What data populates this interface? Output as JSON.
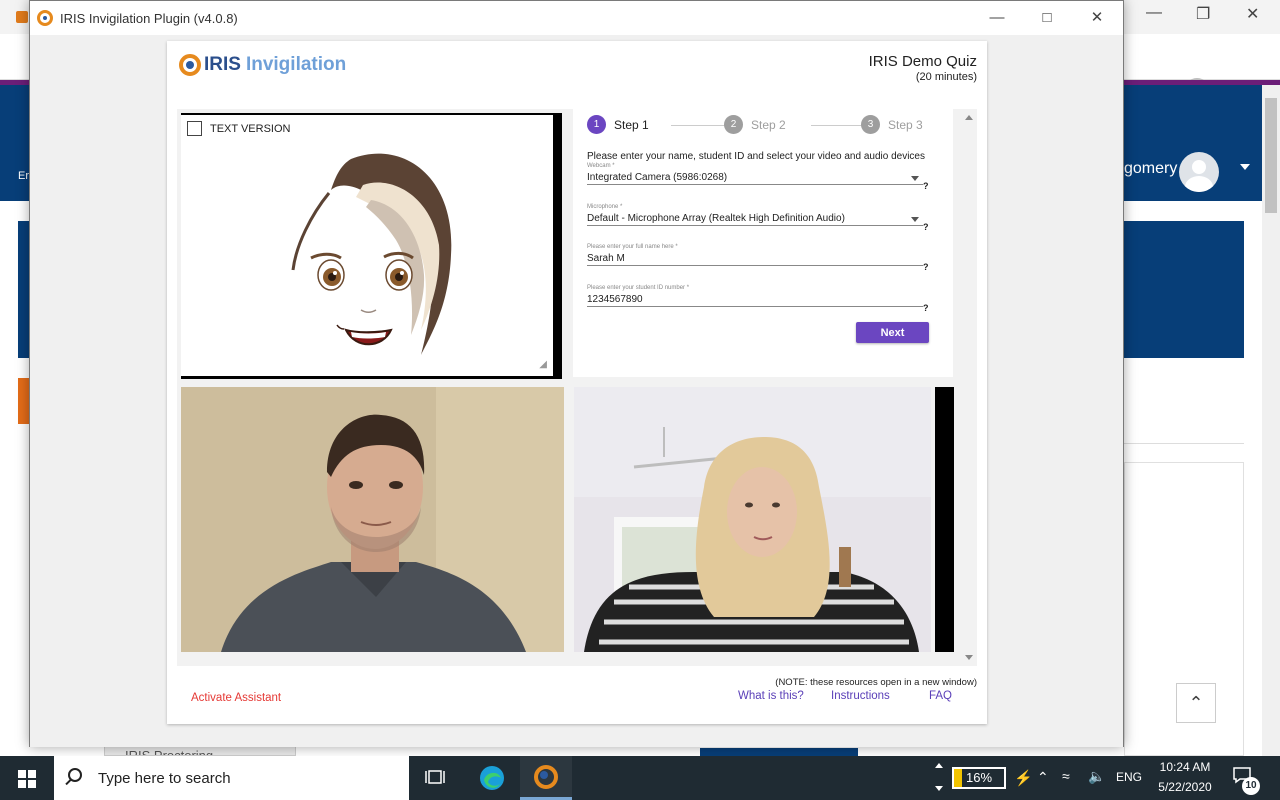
{
  "background": {
    "user_name_partial": "gomery",
    "left_partial": "Er",
    "bottom_tab": "IRIS Proctoring"
  },
  "window": {
    "title": "IRIS Invigilation Plugin (v4.0.8)"
  },
  "brand": {
    "iris": "IRIS",
    "invigilation": "Invigilation"
  },
  "quiz": {
    "title": "IRIS Demo Quiz",
    "duration": "(20 minutes)"
  },
  "avatar_panel": {
    "text_version_label": "TEXT VERSION"
  },
  "stepper": {
    "steps": [
      {
        "number": "1",
        "label": "Step 1",
        "active": true
      },
      {
        "number": "2",
        "label": "Step 2",
        "active": false
      },
      {
        "number": "3",
        "label": "Step 3",
        "active": false
      }
    ]
  },
  "form": {
    "instruction": "Please enter your name, student ID and select your video and audio devices",
    "webcam_label": "Webcam *",
    "webcam_value": "Integrated Camera (5986:0268)",
    "microphone_label": "Microphone *",
    "microphone_value": "Default - Microphone Array (Realtek High Definition Audio)",
    "name_label": "Please enter your full name here *",
    "name_value": "Sarah M",
    "student_id_label": "Please enter your student ID number *",
    "student_id_value": "1234567890",
    "help": "?",
    "next_label": "Next"
  },
  "footer": {
    "activate_assistant": "Activate Assistant",
    "note": "(NOTE: these resources open in a new window)",
    "what_is_this": "What is this?",
    "instructions": "Instructions",
    "faq": "FAQ"
  },
  "taskbar": {
    "search_placeholder": "Type here to search",
    "battery_percent": "16%",
    "battery_level": 0.16,
    "language": "ENG",
    "time": "10:24 AM",
    "date": "5/22/2020",
    "notification_count": "10"
  },
  "colors": {
    "accent_purple": "#6b46c1",
    "link_purple": "#5a3fb8",
    "assistant_red": "#e53935",
    "header_blue": "#073e78"
  }
}
